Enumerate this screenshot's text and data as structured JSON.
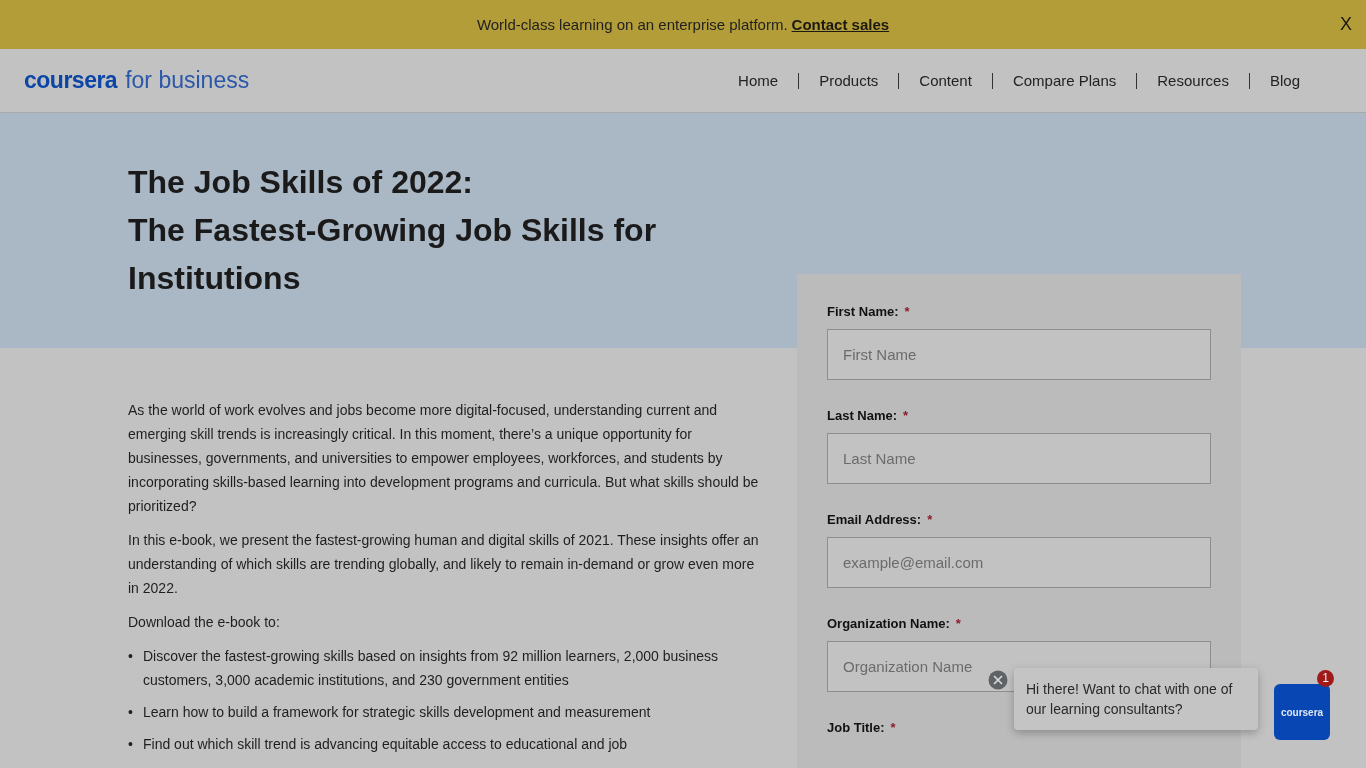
{
  "banner": {
    "text": "World-class learning on an enterprise platform.",
    "link": "Contact sales",
    "close": "X"
  },
  "header": {
    "logo_brand": "coursera",
    "logo_suffix": "for business",
    "nav": [
      "Home",
      "Products",
      "Content",
      "Compare Plans",
      "Resources",
      "Blog"
    ]
  },
  "hero": {
    "title_lines": [
      "The Job Skills of 2022:",
      "The Fastest-Growing Job Skills for Institutions"
    ]
  },
  "article": {
    "paragraphs": [
      "As the world of work evolves and jobs become more digital-focused, understanding current and emerging skill trends is increasingly critical. In this moment, there’s a unique opportunity for businesses, governments, and universities to empower employees, workforces, and students by incorporating skills-based learning into development programs and curricula. But what skills should be prioritized?",
      "In this e-book, we present the fastest-growing human and digital skills of 2021. These insights offer an understanding of which skills are trending globally, and likely to remain in-demand or grow even more in 2022.",
      "Download the e-book to:"
    ],
    "bullet_marker": "•",
    "bullets": [
      "Discover the fastest-growing skills based on insights from 92 million learners, 2,000 business customers, 3,000 academic institutions, and 230 government entities",
      "Learn how to build a framework for strategic skills development and measurement",
      "Find out which skill trend is advancing equitable access to educational and job"
    ]
  },
  "form": {
    "fields": [
      {
        "label": "First Name:",
        "mark": "*",
        "placeholder": "First Name"
      },
      {
        "label": "Last Name:",
        "mark": "*",
        "placeholder": "Last Name"
      },
      {
        "label": "Email Address:",
        "mark": "*",
        "placeholder": "example@email.com"
      },
      {
        "label": "Organization Name:",
        "mark": "*",
        "placeholder": "Organization Name"
      },
      {
        "label": "Job Title:",
        "mark": "*"
      }
    ]
  },
  "chat": {
    "message": "Hi there! Want to chat with one of our learning consultants?",
    "brand": "coursera",
    "badge": "1"
  }
}
